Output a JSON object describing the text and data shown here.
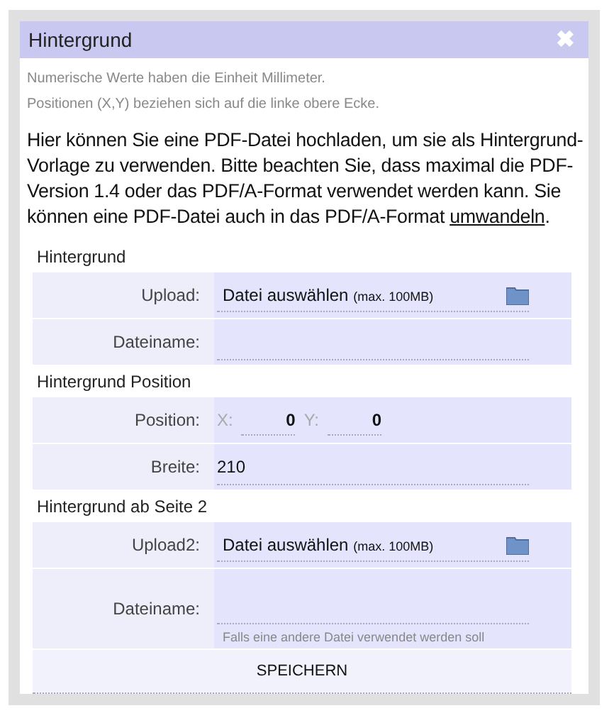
{
  "dialog": {
    "title": "Hintergrund",
    "close": "✖"
  },
  "notes": [
    "Numerische Werte haben die Einheit Millimeter.",
    "Positionen (X,Y) beziehen sich auf die linke obere Ecke."
  ],
  "intro": {
    "text": "Hier können Sie eine PDF-Datei hochladen, um sie als Hintergrund-Vorlage zu verwenden. Bitte beachten Sie, dass maximal die PDF-Version 1.4 oder das PDF/A-Format verwendet werden kann. Sie können eine PDF-Datei auch in das PDF/A-Format ",
    "link": "umwandeln",
    "end": "."
  },
  "sections": [
    {
      "title": "Hintergrund",
      "rows": [
        {
          "kind": "upload",
          "label": "Upload:",
          "button": "Datei auswählen",
          "hint": "(max. 100MB)"
        },
        {
          "kind": "text",
          "label": "Dateiname:"
        }
      ]
    },
    {
      "title": "Hintergrund Position",
      "rows": [
        {
          "kind": "position",
          "label": "Position:",
          "x_label": "X:",
          "x_value": "0",
          "y_label": "Y:",
          "y_value": "0"
        },
        {
          "kind": "text",
          "label": "Breite:",
          "value": "210"
        }
      ]
    },
    {
      "title": "Hintergrund ab Seite 2",
      "rows": [
        {
          "kind": "upload",
          "label": "Upload2:",
          "button": "Datei auswählen",
          "hint": "(max. 100MB)"
        },
        {
          "kind": "text",
          "label": "Dateiname:",
          "note": "Falls eine andere Datei verwendet werden soll"
        }
      ]
    }
  ],
  "save": "SPEICHERN"
}
